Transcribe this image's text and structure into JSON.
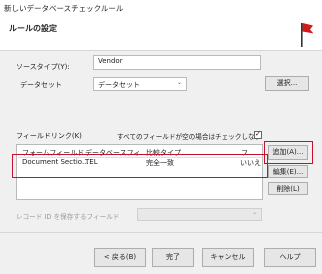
{
  "window": {
    "title": "新しいデータベースチェックルール"
  },
  "header": {
    "title": "ルールの設定"
  },
  "source_type": {
    "label": "ソースタイプ(Y):",
    "value": "Vendor"
  },
  "dataset": {
    "label": "データセット",
    "value": "データセット",
    "select_label": "選択..."
  },
  "field_link": {
    "label": "フィールドリンク(K)",
    "checkbox_label": "すべてのフィールドが空の場合はチェックしない",
    "checked": true,
    "columns": [
      "フォームフィールド",
      "データベースフィ...",
      "比較タイプ",
      "フ..."
    ],
    "rows": [
      [
        "Document Sectio...",
        "TEL",
        "完全一致",
        "いいえ"
      ]
    ]
  },
  "side_buttons": {
    "add": "追加(A)...",
    "edit": "編集(E)...",
    "delete": "削除(L)"
  },
  "record_id": {
    "label": "レコード ID を保存するフィールド"
  },
  "footer": {
    "back": "< 戻る(B)",
    "finish": "完了",
    "cancel": "キャンセル",
    "help": "ヘルプ"
  },
  "colors": {
    "highlight": "#c8102e",
    "flag": "#d11a1a"
  },
  "icons": {
    "flag": "red-flag-icon",
    "dropdown": "chevron-down-icon",
    "checkbox": "checkbox-icon"
  }
}
